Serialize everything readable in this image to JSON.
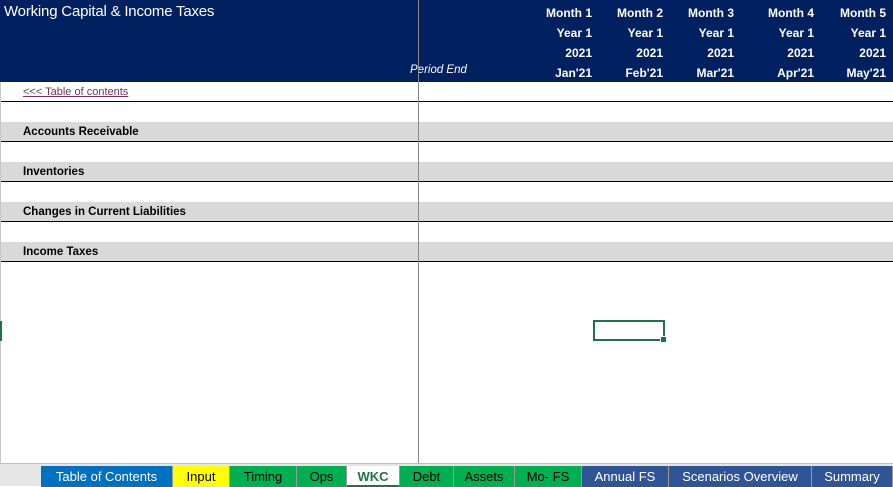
{
  "sheet": {
    "title": "Working Capital & Income Taxes",
    "period_end_label": "Period End",
    "toc_link": "<<< Table of contents"
  },
  "months": [
    {
      "month": "Month 1",
      "year": "Year 1",
      "yyyy": "2021",
      "date": "Jan'21"
    },
    {
      "month": "Month 2",
      "year": "Year 1",
      "yyyy": "2021",
      "date": "Feb'21"
    },
    {
      "month": "Month 3",
      "year": "Year 1",
      "yyyy": "2021",
      "date": "Mar'21"
    },
    {
      "month": "Month 4",
      "year": "Year 1",
      "yyyy": "2021",
      "date": "Apr'21"
    },
    {
      "month": "Month 5",
      "year": "Year 1",
      "yyyy": "2021",
      "date": "May'21"
    }
  ],
  "sections": [
    {
      "label": "Accounts Receivable"
    },
    {
      "label": "Inventories"
    },
    {
      "label": "Changes in Current Liabilities"
    },
    {
      "label": "Income Taxes"
    }
  ],
  "tabs": [
    {
      "label": "Table of Contents",
      "color": "#0070c0",
      "text_color": "#ffffff"
    },
    {
      "label": "Input",
      "color": "#ffff00",
      "text_color": "#000000"
    },
    {
      "label": "Timing",
      "color": "#00b050",
      "text_color": "#000000"
    },
    {
      "label": "Ops",
      "color": "#00b050",
      "text_color": "#000000"
    },
    {
      "label": "WKC",
      "color": "#ffffff",
      "text_color": "#217346",
      "active": true
    },
    {
      "label": "Debt",
      "color": "#00b050",
      "text_color": "#000000"
    },
    {
      "label": "Assets",
      "color": "#00b050",
      "text_color": "#000000"
    },
    {
      "label": "Mo- FS",
      "color": "#00b050",
      "text_color": "#000000"
    },
    {
      "label": "Annual FS",
      "color": "#2f5597",
      "text_color": "#ffffff"
    },
    {
      "label": "Scenarios Overview",
      "color": "#2f5597",
      "text_color": "#ffffff"
    },
    {
      "label": "Summary",
      "color": "#2f5597",
      "text_color": "#ffffff"
    }
  ],
  "colors": {
    "header_bg": "#002060",
    "section_bg": "#d9d9d9",
    "selection": "#217346"
  }
}
